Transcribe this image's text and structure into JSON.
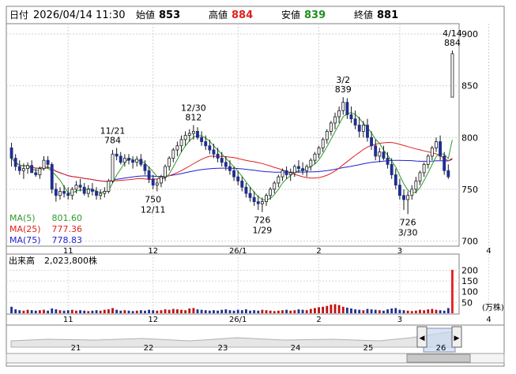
{
  "header": {
    "date_label": "日付",
    "date_value": "2026/04/14 11:30",
    "open_label": "始値",
    "open_value": "853",
    "high_label": "高値",
    "high_value": "884",
    "low_label": "安値",
    "low_value": "839",
    "close_label": "終値",
    "close_value": "881"
  },
  "colors": {
    "up": "#ffffff",
    "down": "#1f2f8f",
    "ma5": "#2e9a2e",
    "ma25": "#e02020",
    "ma75": "#2020d0",
    "volume": "#c01010",
    "highlight": "#e02020"
  },
  "legend": [
    {
      "label": "MA(5)",
      "value": "801.60",
      "color": "#2e9a2e"
    },
    {
      "label": "MA(25)",
      "value": "777.36",
      "color": "#e02020"
    },
    {
      "label": "MA(75)",
      "value": "778.83",
      "color": "#2020d0"
    }
  ],
  "volume_header": {
    "label": "出来高",
    "value": "2,023,800株"
  },
  "volume_unit": "(万株)",
  "chart_data": [
    {
      "type": "candlestick",
      "ylim": [
        695,
        910
      ],
      "y_ticks": [
        700,
        750,
        800,
        850,
        900
      ],
      "x_ticks": [
        {
          "label": "11",
          "index": 14
        },
        {
          "label": "12",
          "index": 35
        },
        {
          "label": "26/1",
          "index": 56
        },
        {
          "label": "2",
          "index": 76
        },
        {
          "label": "3",
          "index": 96
        },
        {
          "label": "4",
          "index": 118
        }
      ],
      "candles": [
        [
          790,
          795,
          772,
          780
        ],
        [
          780,
          784,
          768,
          772
        ],
        [
          772,
          778,
          764,
          768
        ],
        [
          768,
          775,
          760,
          770
        ],
        [
          770,
          776,
          765,
          773
        ],
        [
          773,
          778,
          768,
          766
        ],
        [
          766,
          770,
          762,
          764
        ],
        [
          764,
          772,
          760,
          770
        ],
        [
          770,
          782,
          768,
          778
        ],
        [
          778,
          782,
          770,
          774
        ],
        [
          774,
          776,
          746,
          750
        ],
        [
          750,
          756,
          738,
          744
        ],
        [
          744,
          752,
          740,
          748
        ],
        [
          748,
          754,
          742,
          746
        ],
        [
          746,
          752,
          740,
          744
        ],
        [
          744,
          752,
          740,
          750
        ],
        [
          750,
          758,
          746,
          754
        ],
        [
          754,
          760,
          748,
          752
        ],
        [
          752,
          756,
          744,
          746
        ],
        [
          746,
          754,
          742,
          750
        ],
        [
          750,
          756,
          744,
          748
        ],
        [
          748,
          752,
          740,
          744
        ],
        [
          744,
          750,
          740,
          746
        ],
        [
          746,
          752,
          742,
          748
        ],
        [
          748,
          760,
          746,
          758
        ],
        [
          758,
          788,
          756,
          784
        ],
        [
          784,
          790,
          778,
          782
        ],
        [
          782,
          786,
          774,
          776
        ],
        [
          776,
          784,
          772,
          780
        ],
        [
          780,
          784,
          774,
          778
        ],
        [
          778,
          782,
          770,
          776
        ],
        [
          776,
          782,
          772,
          779
        ],
        [
          779,
          784,
          772,
          774
        ],
        [
          774,
          778,
          764,
          768
        ],
        [
          768,
          772,
          756,
          760
        ],
        [
          760,
          764,
          750,
          754
        ],
        [
          754,
          760,
          748,
          756
        ],
        [
          756,
          764,
          752,
          762
        ],
        [
          762,
          774,
          758,
          772
        ],
        [
          772,
          782,
          768,
          780
        ],
        [
          780,
          790,
          776,
          788
        ],
        [
          788,
          796,
          782,
          792
        ],
        [
          792,
          802,
          786,
          798
        ],
        [
          798,
          806,
          792,
          802
        ],
        [
          802,
          808,
          796,
          804
        ],
        [
          804,
          812,
          798,
          806
        ],
        [
          806,
          810,
          798,
          800
        ],
        [
          800,
          806,
          792,
          796
        ],
        [
          796,
          802,
          788,
          792
        ],
        [
          792,
          798,
          784,
          788
        ],
        [
          788,
          794,
          780,
          784
        ],
        [
          784,
          790,
          776,
          780
        ],
        [
          780,
          786,
          772,
          776
        ],
        [
          776,
          782,
          768,
          772
        ],
        [
          772,
          778,
          764,
          768
        ],
        [
          768,
          772,
          758,
          762
        ],
        [
          762,
          768,
          754,
          758
        ],
        [
          758,
          762,
          748,
          752
        ],
        [
          752,
          756,
          742,
          746
        ],
        [
          746,
          752,
          738,
          742
        ],
        [
          742,
          748,
          734,
          738
        ],
        [
          738,
          744,
          730,
          736
        ],
        [
          736,
          742,
          728,
          738
        ],
        [
          738,
          746,
          734,
          744
        ],
        [
          744,
          752,
          740,
          750
        ],
        [
          750,
          758,
          746,
          756
        ],
        [
          756,
          764,
          752,
          762
        ],
        [
          762,
          770,
          758,
          768
        ],
        [
          768,
          772,
          760,
          764
        ],
        [
          764,
          770,
          758,
          766
        ],
        [
          766,
          774,
          762,
          772
        ],
        [
          772,
          778,
          766,
          770
        ],
        [
          770,
          776,
          764,
          768
        ],
        [
          768,
          774,
          762,
          772
        ],
        [
          772,
          780,
          768,
          778
        ],
        [
          778,
          786,
          774,
          784
        ],
        [
          784,
          792,
          780,
          790
        ],
        [
          790,
          800,
          786,
          798
        ],
        [
          798,
          808,
          794,
          806
        ],
        [
          806,
          816,
          802,
          814
        ],
        [
          814,
          824,
          808,
          820
        ],
        [
          820,
          830,
          814,
          826
        ],
        [
          826,
          839,
          822,
          834
        ],
        [
          834,
          838,
          818,
          822
        ],
        [
          822,
          830,
          814,
          818
        ],
        [
          818,
          826,
          808,
          812
        ],
        [
          812,
          820,
          800,
          806
        ],
        [
          806,
          816,
          800,
          812
        ],
        [
          812,
          818,
          796,
          800
        ],
        [
          800,
          806,
          788,
          792
        ],
        [
          792,
          798,
          778,
          782
        ],
        [
          782,
          790,
          776,
          786
        ],
        [
          786,
          792,
          778,
          780
        ],
        [
          780,
          786,
          770,
          774
        ],
        [
          774,
          780,
          760,
          764
        ],
        [
          764,
          770,
          750,
          754
        ],
        [
          754,
          760,
          740,
          744
        ],
        [
          744,
          750,
          730,
          740
        ],
        [
          740,
          748,
          726,
          744
        ],
        [
          744,
          754,
          740,
          750
        ],
        [
          750,
          762,
          746,
          758
        ],
        [
          758,
          768,
          754,
          766
        ],
        [
          766,
          776,
          762,
          774
        ],
        [
          774,
          784,
          770,
          782
        ],
        [
          782,
          792,
          778,
          790
        ],
        [
          790,
          800,
          786,
          796
        ],
        [
          796,
          802,
          778,
          782
        ],
        [
          782,
          786,
          764,
          768
        ],
        [
          768,
          774,
          760,
          762
        ],
        [
          839,
          884,
          839,
          881
        ]
      ],
      "annotations": [
        {
          "text": "11/21",
          "sub": "784",
          "index": 25,
          "value": 790,
          "pos": "above"
        },
        {
          "text": "12/30",
          "sub": "812",
          "index": 45,
          "value": 812,
          "pos": "above"
        },
        {
          "text": "3/2",
          "sub": "839",
          "index": 82,
          "value": 839,
          "pos": "above"
        },
        {
          "text": "4/14",
          "sub": "884",
          "index": 109,
          "value": 884,
          "pos": "above"
        },
        {
          "text": "750",
          "sub": "12/11",
          "index": 35,
          "value": 748,
          "pos": "below"
        },
        {
          "text": "726",
          "sub": "1/29",
          "index": 62,
          "value": 728,
          "pos": "below"
        },
        {
          "text": "726",
          "sub": "3/30",
          "index": 98,
          "value": 726,
          "pos": "below"
        }
      ]
    },
    {
      "type": "bar",
      "title": "出来高",
      "unit": "(万株)",
      "ylim": [
        0,
        220
      ],
      "y_ticks": [
        50,
        100,
        150,
        200
      ],
      "values": [
        30,
        18,
        14,
        12,
        16,
        14,
        12,
        14,
        16,
        12,
        22,
        18,
        14,
        12,
        14,
        16,
        12,
        14,
        12,
        10,
        12,
        14,
        12,
        16,
        18,
        24,
        16,
        12,
        14,
        12,
        10,
        12,
        14,
        12,
        16,
        14,
        12,
        14,
        18,
        16,
        20,
        18,
        16,
        14,
        22,
        24,
        18,
        16,
        14,
        12,
        14,
        12,
        16,
        18,
        14,
        12,
        16,
        14,
        18,
        12,
        14,
        12,
        16,
        14,
        12,
        10,
        12,
        14,
        16,
        12,
        14,
        18,
        16,
        14,
        20,
        24,
        28,
        30,
        34,
        40,
        42,
        38,
        30,
        26,
        22,
        18,
        16,
        14,
        20,
        18,
        16,
        14,
        12,
        18,
        22,
        24,
        16,
        14,
        12,
        10,
        12,
        16,
        14,
        18,
        20,
        16,
        14,
        12,
        24,
        202
      ]
    }
  ],
  "navigator": {
    "labels": [
      "21",
      "22",
      "23",
      "24",
      "25",
      "26"
    ],
    "left_arrow": "◀",
    "right_arrow": "▶"
  }
}
